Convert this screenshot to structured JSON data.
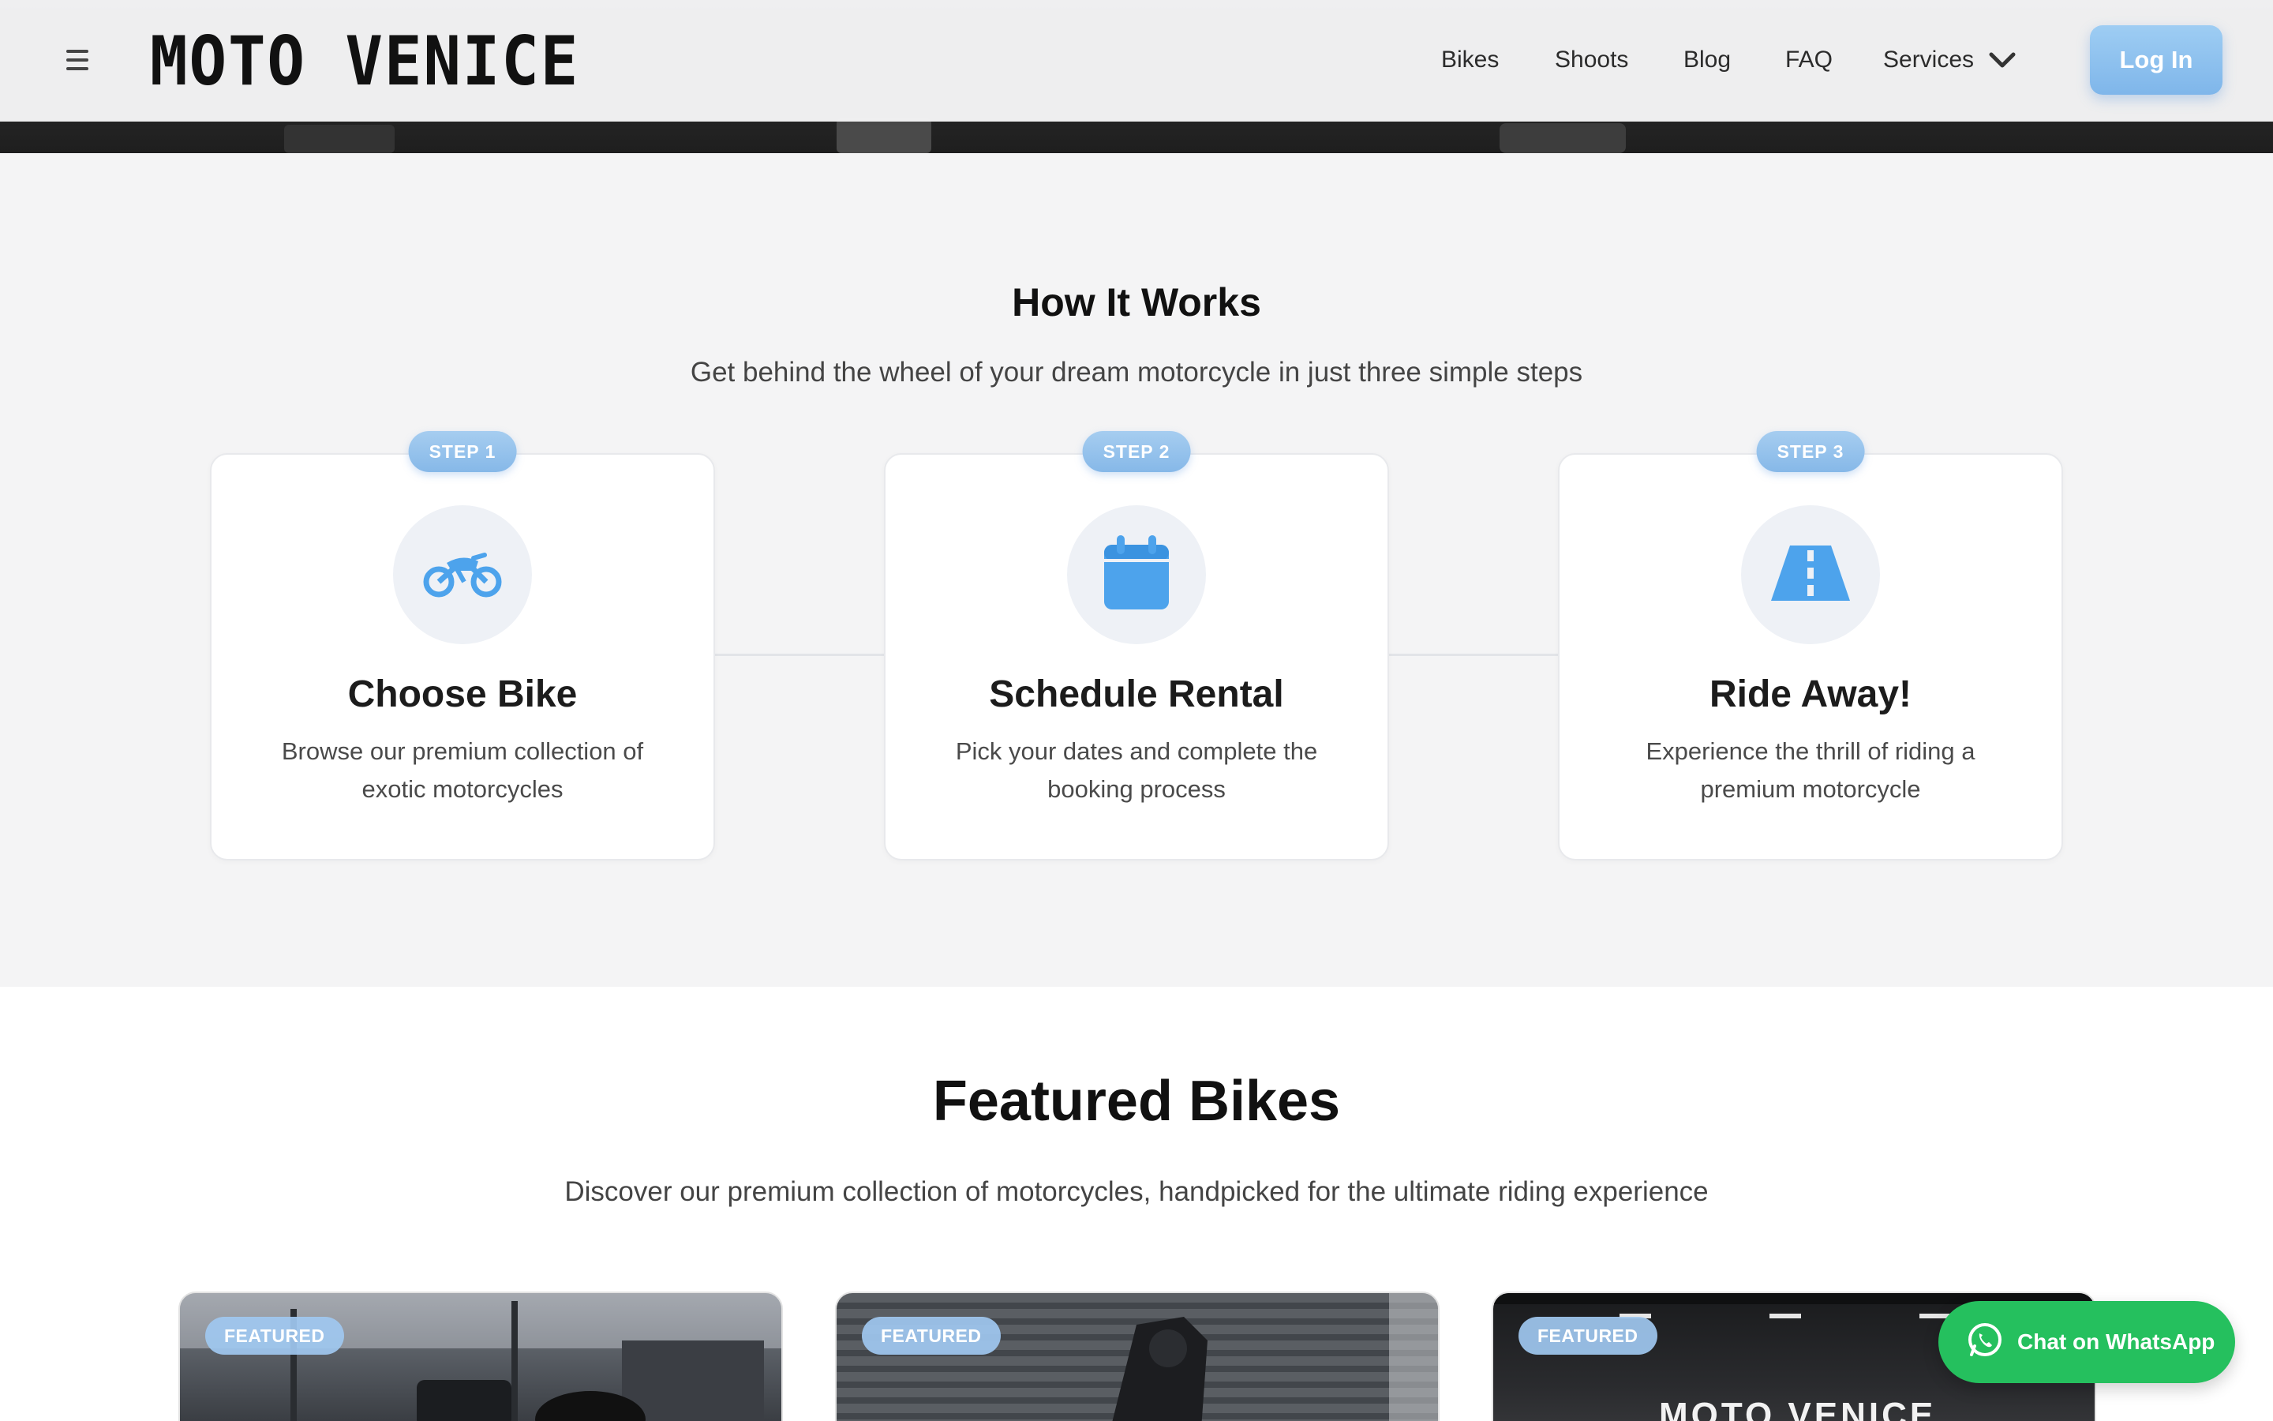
{
  "header": {
    "brand": "MOTO VENICE",
    "nav": [
      {
        "label": "Bikes"
      },
      {
        "label": "Shoots"
      },
      {
        "label": "Blog"
      },
      {
        "label": "FAQ"
      },
      {
        "label": "Services"
      }
    ],
    "login_label": "Log In"
  },
  "how_it_works": {
    "title": "How It Works",
    "subtitle": "Get behind the wheel of your dream motorcycle in just three simple steps",
    "steps": [
      {
        "badge": "STEP 1",
        "icon": "motorcycle-icon",
        "title": "Choose Bike",
        "description": "Browse our premium collection of exotic motorcycles"
      },
      {
        "badge": "STEP 2",
        "icon": "calendar-icon",
        "title": "Schedule Rental",
        "description": "Pick your dates and complete the booking process"
      },
      {
        "badge": "STEP 3",
        "icon": "road-icon",
        "title": "Ride Away!",
        "description": "Experience the thrill of riding a premium motorcycle"
      }
    ]
  },
  "featured": {
    "title": "Featured Bikes",
    "subtitle": "Discover our premium collection of motorcycles, handpicked for the ultimate riding experience",
    "cards": [
      {
        "badge": "FEATURED"
      },
      {
        "badge": "FEATURED"
      },
      {
        "badge": "FEATURED",
        "photo_text": "MOTO VENICE"
      }
    ]
  },
  "whatsapp": {
    "label": "Chat on WhatsApp"
  },
  "colors": {
    "accent": "#7fb6ea",
    "icon_blue": "#4da3ec",
    "whatsapp_green": "#25c05e",
    "section_bg": "#f4f4f5"
  }
}
